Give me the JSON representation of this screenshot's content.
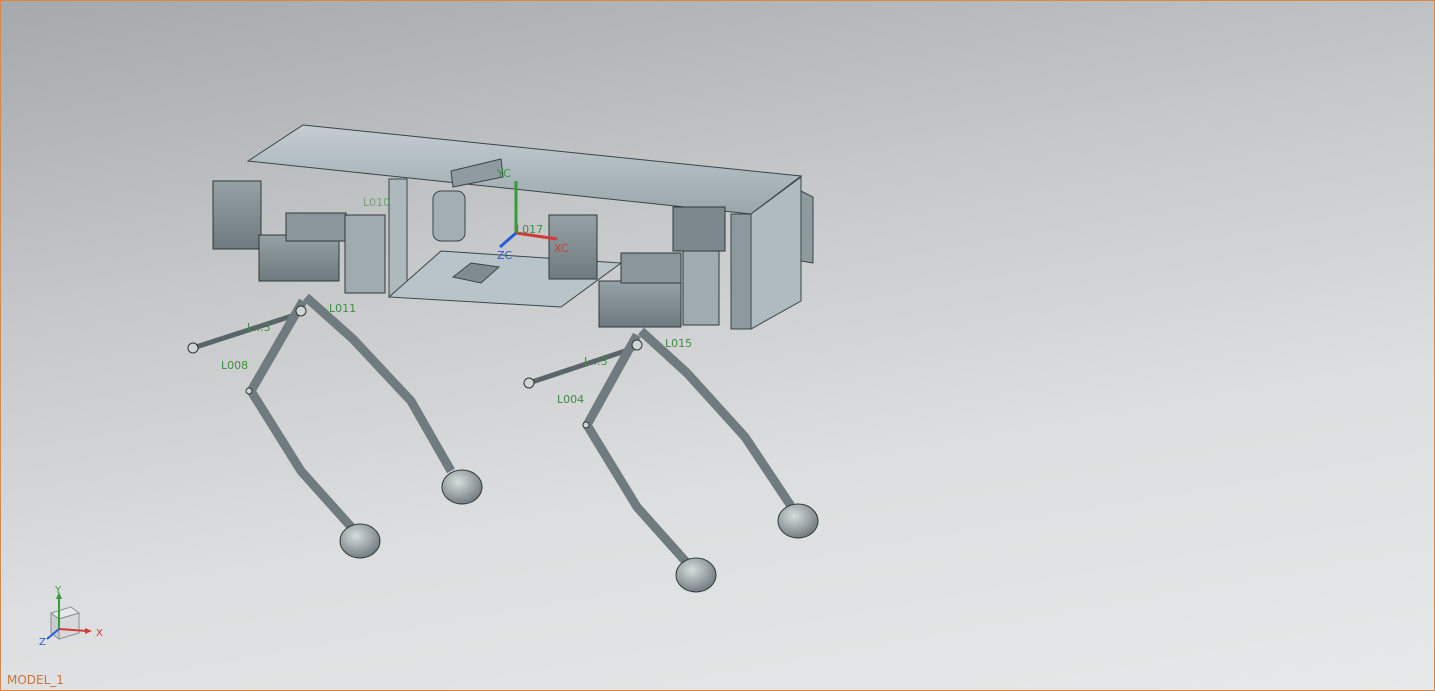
{
  "viewport": {
    "model_name": "MODEL_1"
  },
  "wcs": {
    "y_label": "YC",
    "x_label": "XC",
    "z_label": "ZC",
    "origin_label": "L017"
  },
  "component_labels": {
    "front_upper": "L011",
    "front_lower": "L008",
    "rear_upper": "L015",
    "rear_lower": "L004",
    "front_mid": "L...3",
    "rear_mid": "L...3",
    "hidden_body": "L010"
  },
  "view_triad": {
    "y": "Y",
    "x": "X",
    "z": "Z"
  },
  "colors": {
    "frame": "#b8c4c8",
    "frame_dark": "#8a969a",
    "servo": "#7d8a8e",
    "label_green": "#3f8f3f",
    "axis_x": "#d23a3a",
    "axis_y": "#3b9a3b",
    "axis_z": "#2a5bd6",
    "border": "#d8884a"
  }
}
